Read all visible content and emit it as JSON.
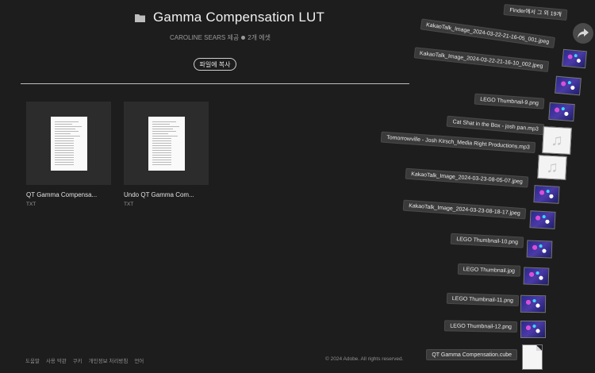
{
  "header": {
    "title": "Gamma Compensation LUT",
    "owner": "CAROLINE SEARS 제공",
    "asset_count": "2개 에셋",
    "copy_button": "파일에 복사"
  },
  "assets": [
    {
      "name": "QT Gamma Compensa...",
      "type": "TXT"
    },
    {
      "name": "Undo QT Gamma Com...",
      "type": "TXT"
    }
  ],
  "footer": {
    "links": [
      "도움말",
      "사용 약관",
      "쿠키",
      "개인정보 처리방침",
      "언어"
    ],
    "copyright": "© 2024 Adobe. All rights reserved."
  },
  "drag_stack": {
    "header_label": "Finder에서 그 외 19개",
    "items": [
      {
        "label": "KakaoTalk_Image_2024-03-22-21-16-05_001.jpeg",
        "thumb": "image"
      },
      {
        "label": "KakaoTalk_Image_2024-03-22-21-16-10_002.jpeg",
        "thumb": "image"
      },
      {
        "label": "LEGO Thumbnail-9.png",
        "thumb": "image"
      },
      {
        "label": "Cat Shat in the Box - josh pan.mp3",
        "thumb": "audio"
      },
      {
        "label": "Tomorrowville - Josh Kirsch_Media Right Productions.mp3",
        "thumb": "audio"
      },
      {
        "label": "KakaoTalk_Image_2024-03-23-08-05-07.jpeg",
        "thumb": "image"
      },
      {
        "label": "KakaoTalk_Image_2024-03-23-08-18-17.jpeg",
        "thumb": "image"
      },
      {
        "label": "LEGO Thumbnail-10.png",
        "thumb": "image"
      },
      {
        "label": "LEGO Thumbnail.jpg",
        "thumb": "image"
      },
      {
        "label": "LEGO Thumbnail-11.png",
        "thumb": "image"
      },
      {
        "label": "LEGO Thumbnail-12.png",
        "thumb": "image"
      },
      {
        "label": "QT Gamma Compensation.cube",
        "thumb": "file"
      }
    ]
  }
}
